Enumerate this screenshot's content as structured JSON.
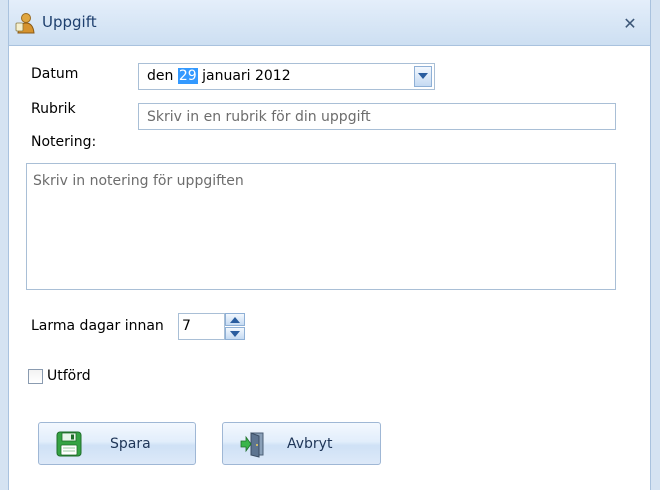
{
  "window": {
    "title": "Uppgift",
    "close_glyph": "✕"
  },
  "form": {
    "datum_label": "Datum",
    "datum_prefix": "den ",
    "datum_day": "29",
    "datum_suffix": " januari 2012",
    "rubrik_label": "Rubrik",
    "rubrik_placeholder": "Skriv in en rubrik för din uppgift",
    "notering_label": "Notering:",
    "notering_placeholder": "Skriv in notering för uppgiften",
    "larma_label": "Larma dagar innan",
    "larma_value": "7",
    "utford_label": "Utförd",
    "utford_checked": false
  },
  "buttons": {
    "spara": "Spara",
    "avbryt": "Avbryt"
  },
  "colors": {
    "accent": "#3399ff",
    "title_text": "#1e3f6e",
    "frame": "#d5e3f2",
    "save_icon": "#2e9e3a"
  }
}
